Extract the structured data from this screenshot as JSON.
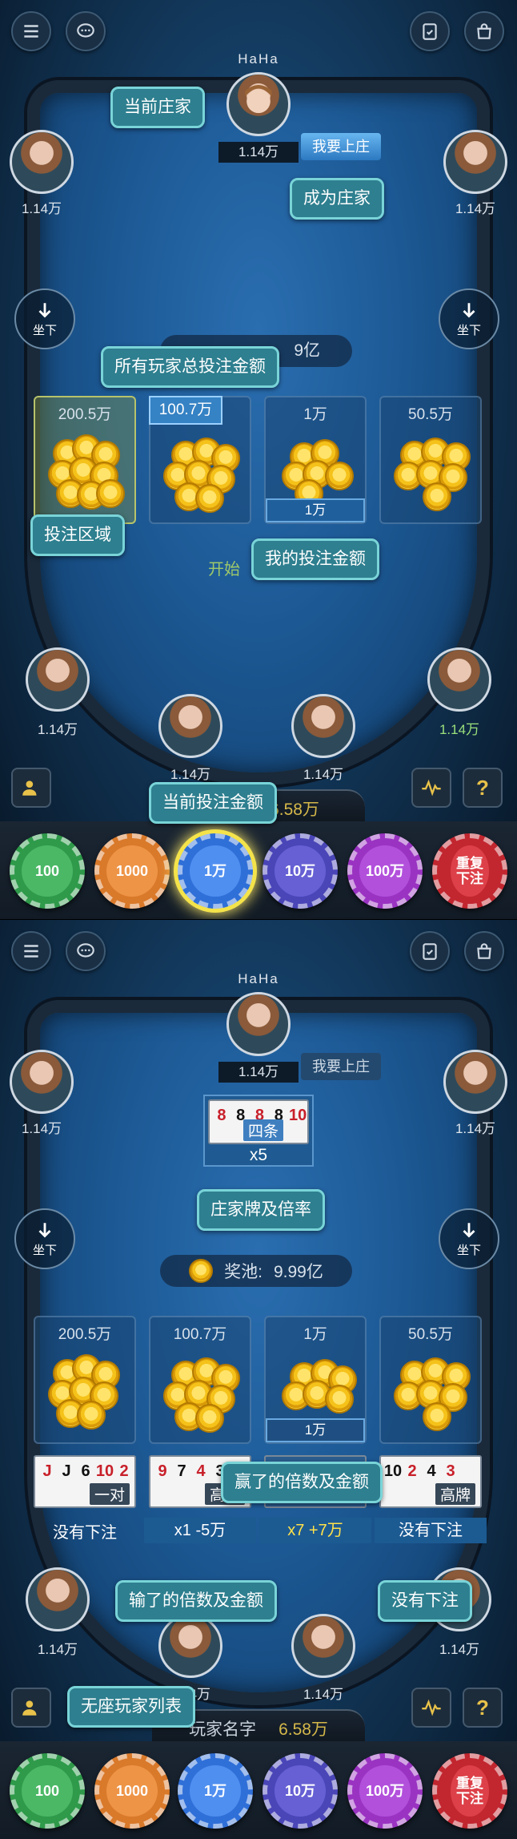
{
  "banker": {
    "name": "HaHa",
    "amount": "1.14万",
    "become_banker_label": "我要上庄"
  },
  "seats": {
    "top_left_amount": "1.14万",
    "top_right_amount": "1.14万",
    "mid_left_amount": "1.14万",
    "mid_right_amount": "1.14万",
    "bottom_left_amount": "1.14万",
    "bottom_right_amount": "1.14万",
    "sit_down_label": "坐下"
  },
  "bet_areas": [
    {
      "total": "200.5万"
    },
    {
      "total": "100.7万"
    },
    {
      "total": "1万",
      "my_bet": "1万"
    },
    {
      "total": "50.5万"
    }
  ],
  "screen1": {
    "pool_partial": "9亿",
    "start_text": "开始",
    "player_total": "6.58万",
    "tips": {
      "current_banker": "当前庄家",
      "become_banker": "成为庄家",
      "all_total_bet": "所有玩家总投注金额",
      "bet_area": "投注区域",
      "my_bet_amount": "我的投注金额",
      "current_bet_amount": "当前投注金额"
    }
  },
  "screen2": {
    "banker_cards": [
      "8",
      "8",
      "8",
      "8",
      "10"
    ],
    "banker_rank": "四条",
    "banker_multiplier": "x5",
    "pool_label": "奖池:",
    "pool_value": "9.99亿",
    "hands": [
      {
        "cards": [
          "J",
          "J",
          "6",
          "10",
          "2"
        ],
        "rank": "一对",
        "result": "没有下注"
      },
      {
        "cards": [
          "9",
          "7",
          "4",
          "3",
          "2"
        ],
        "rank": "高牌",
        "result": "x1 -5万"
      },
      {
        "cards": [
          "",
          "",
          "",
          "",
          ""
        ],
        "rank": "",
        "result": "x7 +7万"
      },
      {
        "cards": [
          "10",
          "2",
          "4",
          "3",
          ""
        ],
        "rank": "高牌",
        "result": "没有下注"
      }
    ],
    "player_name_label": "玩家名字",
    "player_total": "6.58万",
    "tips": {
      "banker_cards_multiplier": "庄家牌及倍率",
      "win_multiplier_amount": "赢了的倍数及金额",
      "lose_multiplier_amount": "输了的倍数及金额",
      "no_bet": "没有下注",
      "standless_list": "无座玩家列表"
    }
  },
  "chips": [
    {
      "label": "100",
      "color": "#2e9a4a"
    },
    {
      "label": "1000",
      "color": "#d9792a"
    },
    {
      "label": "1万",
      "color": "#2f6fd8"
    },
    {
      "label": "10万",
      "color": "#4a46b8"
    },
    {
      "label": "100万",
      "color": "#9a33c2"
    },
    {
      "label": "重复下注",
      "color": "#c2262f"
    }
  ]
}
